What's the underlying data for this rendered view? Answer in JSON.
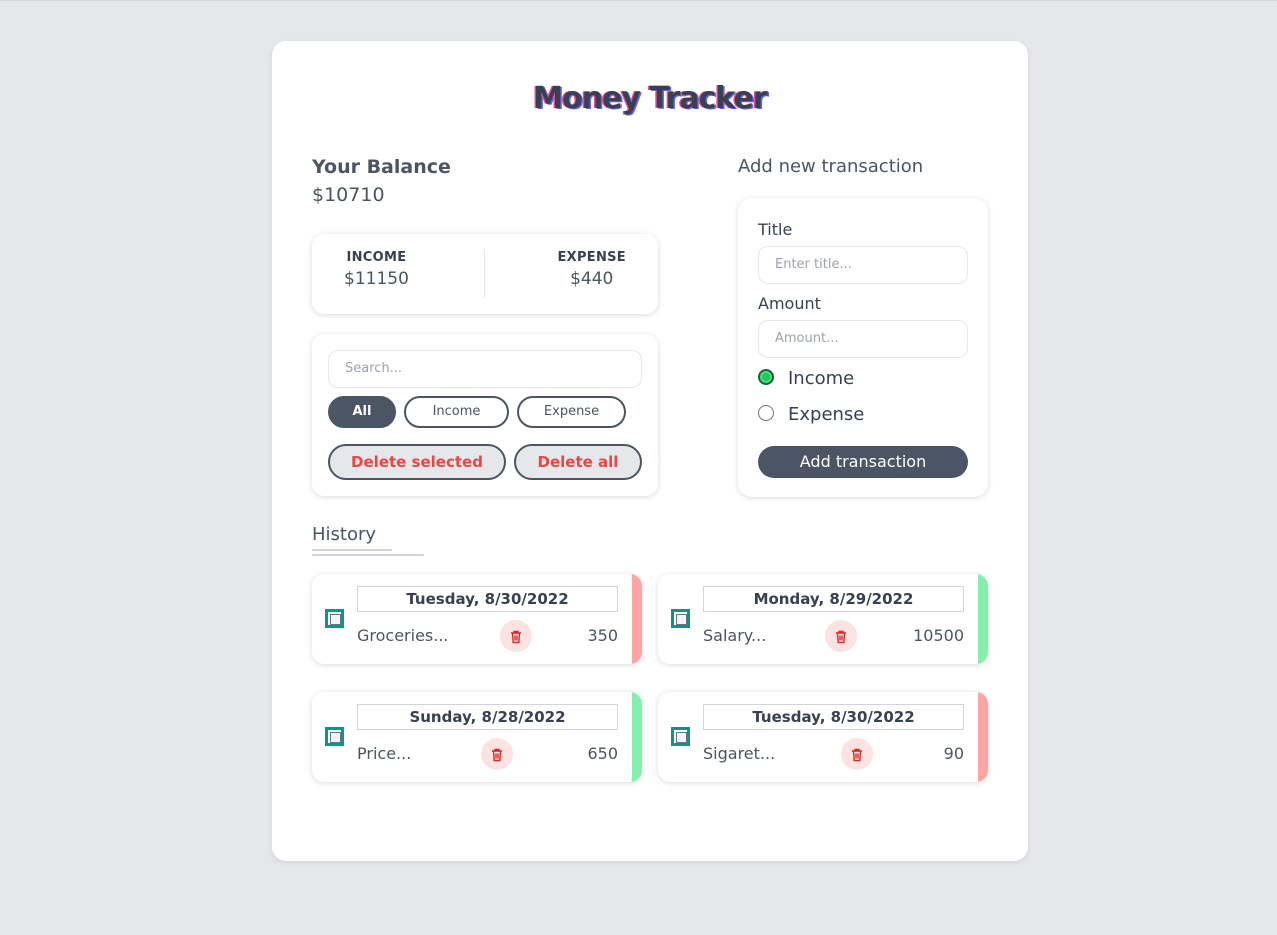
{
  "app": {
    "title": "Money Tracker"
  },
  "balance": {
    "label": "Your Balance",
    "value": "$10710"
  },
  "summary": {
    "income_label": "INCOME",
    "income_value": "$11150",
    "expense_label": "EXPENSE",
    "expense_value": "$440"
  },
  "filters": {
    "search_placeholder": "Search...",
    "chips": [
      {
        "label": "All",
        "active": true
      },
      {
        "label": "Income",
        "active": false
      },
      {
        "label": "Expense",
        "active": false
      }
    ],
    "delete_selected_label": "Delete selected",
    "delete_all_label": "Delete all"
  },
  "history": {
    "label": "History",
    "items": [
      {
        "date": "Tuesday, 8/30/2022",
        "name": "Groceries...",
        "amount": "350",
        "type": "expense"
      },
      {
        "date": "Monday, 8/29/2022",
        "name": "Salary...",
        "amount": "10500",
        "type": "income"
      },
      {
        "date": "Sunday, 8/28/2022",
        "name": "Price...",
        "amount": "650",
        "type": "income"
      },
      {
        "date": "Tuesday, 8/30/2022",
        "name": "Sigaret...",
        "amount": "90",
        "type": "expense"
      }
    ]
  },
  "form": {
    "heading": "Add new transaction",
    "title_label": "Title",
    "title_placeholder": "Enter title...",
    "amount_label": "Amount",
    "amount_placeholder": "Amount...",
    "radio_income": "Income",
    "radio_expense": "Expense",
    "selected_type": "Income",
    "submit_label": "Add transaction"
  },
  "colors": {
    "primary": "#4b5563",
    "danger": "#ef4444",
    "income_stripe": "#86efac",
    "expense_stripe": "#fca5a5",
    "checkbox": "#0d9488"
  }
}
